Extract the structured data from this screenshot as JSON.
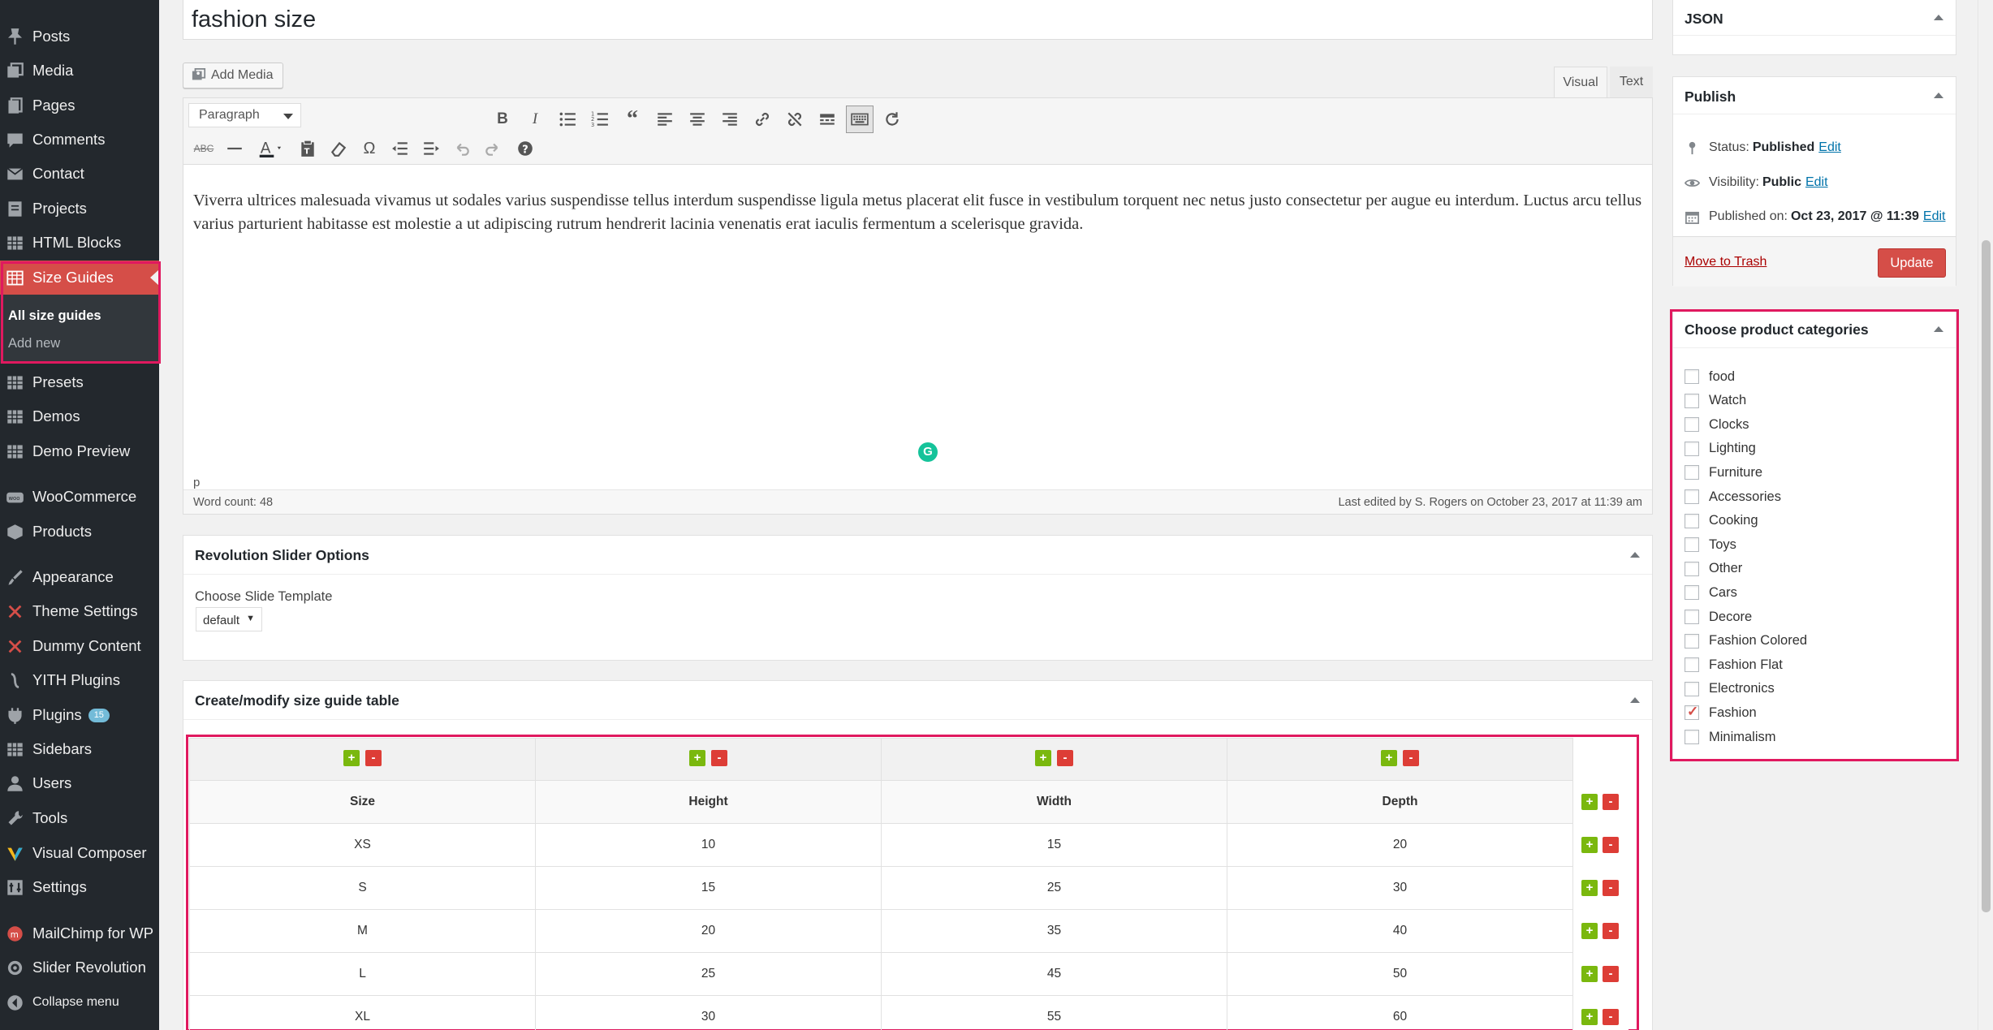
{
  "sidebar": {
    "items": [
      {
        "label": "Posts",
        "icon": "pin-icon"
      },
      {
        "label": "Media",
        "icon": "media-icon"
      },
      {
        "label": "Pages",
        "icon": "pages-icon"
      },
      {
        "label": "Comments",
        "icon": "comments-icon"
      },
      {
        "label": "Contact",
        "icon": "mail-icon"
      },
      {
        "label": "Projects",
        "icon": "projects-icon"
      },
      {
        "label": "HTML Blocks",
        "icon": "grid-icon"
      },
      {
        "label": "Size Guides",
        "icon": "size-guide-icon"
      },
      {
        "label": "Presets",
        "icon": "grid-icon"
      },
      {
        "label": "Demos",
        "icon": "grid-icon"
      },
      {
        "label": "Demo Preview",
        "icon": "grid-icon"
      },
      {
        "label": "WooCommerce",
        "icon": "woocommerce-icon"
      },
      {
        "label": "Products",
        "icon": "products-icon"
      },
      {
        "label": "Appearance",
        "icon": "brush-icon"
      },
      {
        "label": "Theme Settings",
        "icon": "theme-settings-icon"
      },
      {
        "label": "Dummy Content",
        "icon": "dummy-content-icon"
      },
      {
        "label": "YITH Plugins",
        "icon": "yith-icon"
      },
      {
        "label": "Plugins",
        "icon": "plugins-icon",
        "badge": "15"
      },
      {
        "label": "Sidebars",
        "icon": "grid-icon"
      },
      {
        "label": "Users",
        "icon": "users-icon"
      },
      {
        "label": "Tools",
        "icon": "tools-icon"
      },
      {
        "label": "Visual Composer",
        "icon": "visual-composer-icon"
      },
      {
        "label": "Settings",
        "icon": "settings-icon"
      },
      {
        "label": "MailChimp for WP",
        "icon": "mailchimp-icon"
      },
      {
        "label": "Slider Revolution",
        "icon": "slider-revolution-icon"
      },
      {
        "label": "Collapse menu",
        "icon": "collapse-icon"
      }
    ],
    "submenu": {
      "current": "All size guides",
      "add_new": "Add new"
    },
    "active_color": "#d54e48"
  },
  "post": {
    "title": "fashion size",
    "add_media": "Add Media",
    "tab_visual": "Visual",
    "tab_text": "Text",
    "format_select": "Paragraph",
    "content": "Viverra ultrices malesuada vivamus ut sodales varius suspendisse tellus interdum suspendisse ligula metus placerat elit fusce in vestibulum torquent nec netus justo consectetur per augue eu interdum. Luctus arcu tellus varius parturient habitasse est molestie a ut adipiscing rutrum hendrerit lacinia venenatis erat iaculis fermentum a scelerisque gravida.",
    "path": "p",
    "word_count": "Word count: 48",
    "last_edited": "Last edited by S. Rogers on October 23, 2017 at 11:39 am"
  },
  "revslider": {
    "title": "Revolution Slider Options",
    "label": "Choose Slide Template",
    "select_value": "default"
  },
  "sizeguide": {
    "title": "Create/modify size guide table",
    "headers": [
      "Size",
      "Height",
      "Width",
      "Depth"
    ],
    "rows": [
      [
        "XS",
        "10",
        "15",
        "20"
      ],
      [
        "S",
        "15",
        "25",
        "30"
      ],
      [
        "M",
        "20",
        "35",
        "40"
      ],
      [
        "L",
        "25",
        "45",
        "50"
      ],
      [
        "XL",
        "30",
        "55",
        "60"
      ]
    ],
    "add_symbol": "+",
    "remove_symbol": "-"
  },
  "json_box": {
    "title": "JSON"
  },
  "publish": {
    "title": "Publish",
    "status_label": "Status:",
    "status_value": "Published",
    "visibility_label": "Visibility:",
    "visibility_value": "Public",
    "published_label": "Published on:",
    "published_value": "Oct 23, 2017 @ 11:39",
    "edit": "Edit",
    "trash": "Move to Trash",
    "update": "Update"
  },
  "categories": {
    "title": "Choose product categories",
    "items": [
      {
        "label": "food",
        "checked": false
      },
      {
        "label": "Watch",
        "checked": false
      },
      {
        "label": "Clocks",
        "checked": false
      },
      {
        "label": "Lighting",
        "checked": false
      },
      {
        "label": "Furniture",
        "checked": false
      },
      {
        "label": "Accessories",
        "checked": false
      },
      {
        "label": "Cooking",
        "checked": false
      },
      {
        "label": "Toys",
        "checked": false
      },
      {
        "label": "Other",
        "checked": false
      },
      {
        "label": "Cars",
        "checked": false
      },
      {
        "label": "Decore",
        "checked": false
      },
      {
        "label": "Fashion Colored",
        "checked": false
      },
      {
        "label": "Fashion Flat",
        "checked": false
      },
      {
        "label": "Electronics",
        "checked": false
      },
      {
        "label": "Fashion",
        "checked": true
      },
      {
        "label": "Minimalism",
        "checked": false
      }
    ]
  },
  "colors": {
    "highlight": "#e0195f",
    "plus": "#7ab80e",
    "minus": "#dd3d36",
    "update_button": "#d54e48",
    "grammarly": "#15c39a"
  }
}
